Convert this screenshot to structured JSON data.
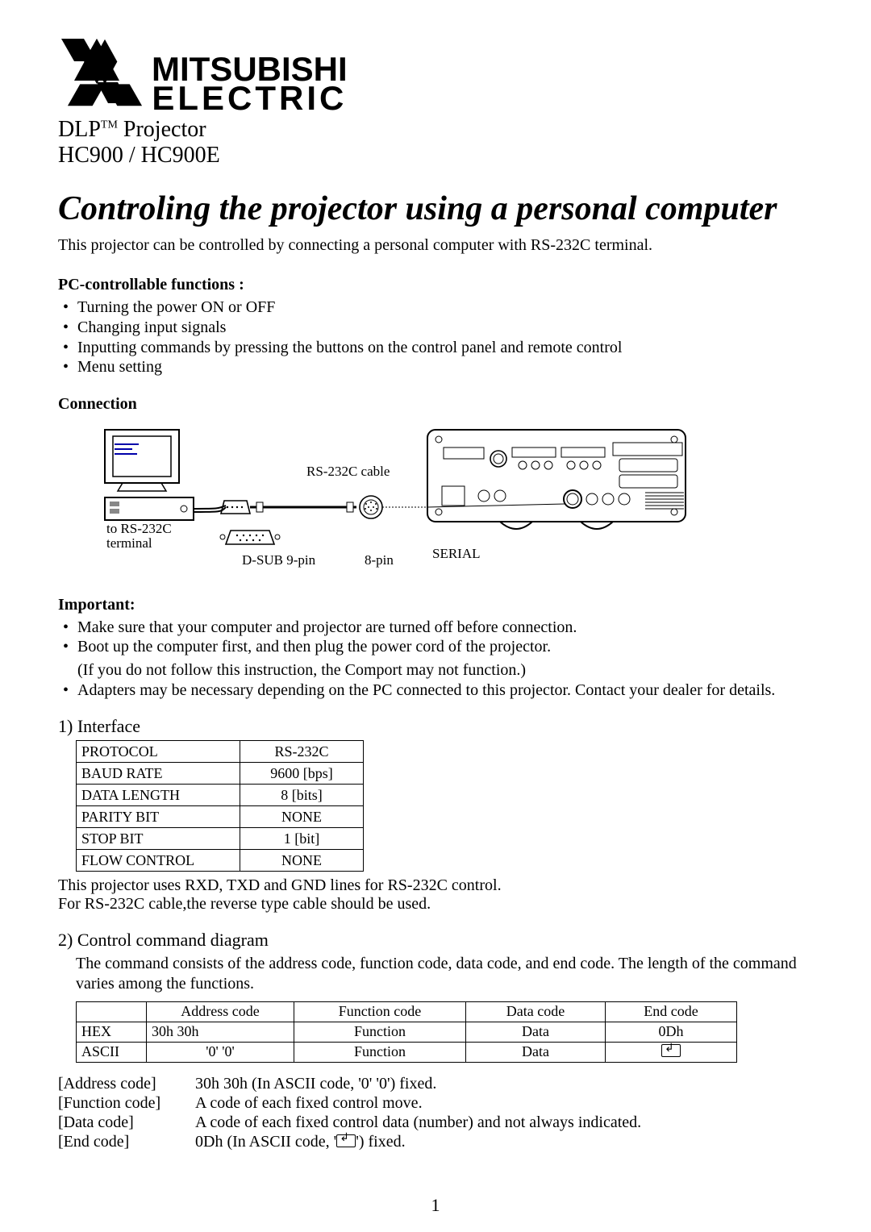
{
  "brand": {
    "line1": "MITSUBISHI",
    "line2": "ELECTRIC"
  },
  "product": {
    "series_prefix": "DLP",
    "series_tm": "TM",
    "series_suffix": " Projector",
    "models": "HC900 / HC900E"
  },
  "title": "Controling the projector using a personal computer",
  "intro": "This projector can be controlled by connecting a personal computer with RS-232C terminal.",
  "pc_funcs_heading": "PC-controllable functions :",
  "pc_funcs": [
    "Turning the power ON or OFF",
    "Changing input signals",
    "Inputting commands by pressing the buttons on the control panel and remote control",
    "Menu setting"
  ],
  "connection_heading": "Connection",
  "diagram_labels": {
    "to_terminal_1": "to RS-232C",
    "to_terminal_2": "terminal",
    "cable": "RS-232C cable",
    "dsub": "D-SUB 9-pin",
    "eightpin": "8-pin",
    "serial": "SERIAL"
  },
  "important_heading": "Important:",
  "important": {
    "b1": "Make sure that your computer and projector are turned off before connection.",
    "b2": "Boot up the computer first, and then plug the power cord of the projector.",
    "b2_paren": "(If you do not follow this instruction, the Comport may not function.)",
    "b3": "Adapters may be necessary depending on the PC connected to this projector. Contact your dealer for details."
  },
  "interface_heading": "1) Interface",
  "interface": [
    {
      "k": "PROTOCOL",
      "v": "RS-232C"
    },
    {
      "k": "BAUD RATE",
      "v": "9600 [bps]"
    },
    {
      "k": "DATA LENGTH",
      "v": "8 [bits]"
    },
    {
      "k": "PARITY BIT",
      "v": "NONE"
    },
    {
      "k": "STOP BIT",
      "v": "1 [bit]"
    },
    {
      "k": "FLOW CONTROL",
      "v": "NONE"
    }
  ],
  "iface_note1": "This projector uses RXD, TXD and GND lines for RS-232C control.",
  "iface_note2": "For RS-232C cable,the reverse type cable should be used.",
  "cc_heading": "2) Control command diagram",
  "cc_desc": "The command consists of the address code, function code, data code, and end code. The length of the command varies among the functions.",
  "cc_table": {
    "headers": [
      "",
      "Address code",
      "Function code",
      "Data code",
      "End code"
    ],
    "rows": [
      {
        "label": "HEX",
        "addr": "30h 30h",
        "fn": "Function",
        "data": "Data",
        "end": "0Dh"
      },
      {
        "label": "ASCII",
        "addr": "'0' '0'",
        "fn": "Function",
        "data": "Data",
        "end": "ENTER"
      }
    ]
  },
  "defs": [
    {
      "k": "[Address code]",
      "v": "30h 30h (In ASCII code, '0' '0') fixed."
    },
    {
      "k": "[Function code]",
      "v": "A code of each fixed control move."
    },
    {
      "k": "[Data code]",
      "v": "A code of each fixed control data (number) and not always indicated."
    },
    {
      "k": "[End code]",
      "v_pre": "0Dh (In ASCII code, '",
      "v_post": "') fixed."
    }
  ],
  "page_number": "1"
}
